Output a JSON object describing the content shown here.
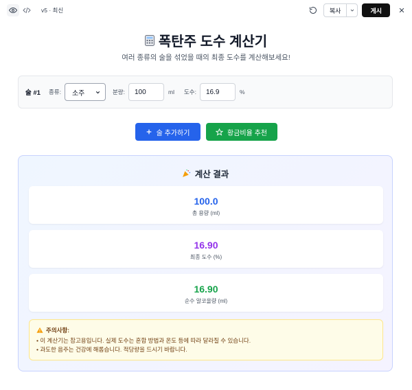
{
  "topbar": {
    "version": "v5 · 최신",
    "copy_label": "복사",
    "publish_label": "게시"
  },
  "header": {
    "title": "폭탄주 도수 계산기",
    "subtitle": "여러 종류의 술을 섞었을 때의 최종 도수를 계산해보세요!"
  },
  "drink": {
    "label": "술 #1",
    "type_label": "종류:",
    "type_value": "소주",
    "amount_label": "분량:",
    "amount_value": "100",
    "amount_unit": "ml",
    "abv_label": "도수:",
    "abv_value": "16.9",
    "abv_unit": "%"
  },
  "actions": {
    "add_label": "술 추가하기",
    "golden_label": "황금비율 추천"
  },
  "results": {
    "title": "계산 결과",
    "stats": [
      {
        "value": "100.0",
        "label": "총 용량 (ml)"
      },
      {
        "value": "16.90",
        "label": "최종 도수 (%)"
      },
      {
        "value": "16.90",
        "label": "순수 알코올량 (ml)"
      }
    ],
    "warning": {
      "title": "주의사항:",
      "lines": [
        "• 이 계산기는 참고용입니다. 실제 도수는 혼합 방법과 온도 등에 따라 달라질 수 있습니다.",
        "• 과도한 음주는 건강에 해롭습니다. 적당량을 드시기 바랍니다."
      ]
    }
  },
  "colors": {
    "primary": "#2563eb",
    "success": "#16a34a",
    "purple": "#9333ea"
  }
}
